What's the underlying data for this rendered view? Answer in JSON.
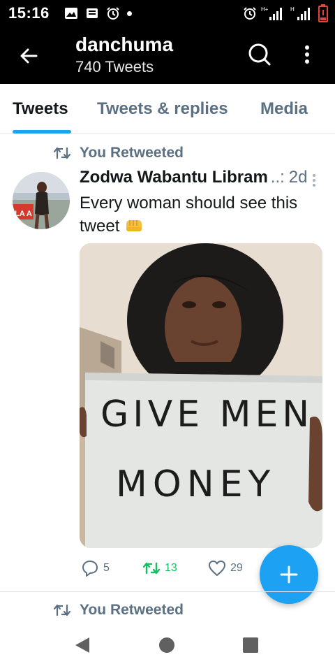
{
  "status_bar": {
    "time": "15:16",
    "icons": [
      "gallery-icon",
      "message-icon",
      "alarm-icon",
      "notification-dot",
      "alarm-icon",
      "hplus-signal-icon",
      "h-signal-icon",
      "battery-low-icon"
    ],
    "hplus_label": "H+",
    "h_label": "H"
  },
  "header": {
    "title": "danchuma",
    "subtitle": "740 Tweets",
    "icons": [
      "back-arrow-icon",
      "search-icon",
      "more-vertical-icon"
    ]
  },
  "tabs": [
    {
      "label": "Tweets",
      "active": true
    },
    {
      "label": "Tweets & replies",
      "active": false
    },
    {
      "label": "Media",
      "active": false
    }
  ],
  "tweet": {
    "retweet_label": "You Retweeted",
    "author": "Zodwa Wabantu Libram",
    "truncation": "..:",
    "date": "2d",
    "text": "Every woman should see this tweet",
    "emoji": "oncoming-fist-emoji",
    "media_sign_line1": "GIVE MEN",
    "media_sign_line2": "MONEY",
    "avatar_badge_text": "LA A",
    "replies": "5",
    "retweets": "13",
    "likes": "29"
  },
  "next_tweet": {
    "retweet_label": "You Retweeted"
  },
  "fab": {
    "icon": "plus-icon"
  },
  "navbar": {
    "icons": [
      "nav-back-icon",
      "nav-home-icon",
      "nav-recents-icon"
    ]
  },
  "colors": {
    "accent": "#1da1f2",
    "retweet_green": "#17bf63",
    "muted": "#5b7083",
    "header_bg": "#000000"
  }
}
